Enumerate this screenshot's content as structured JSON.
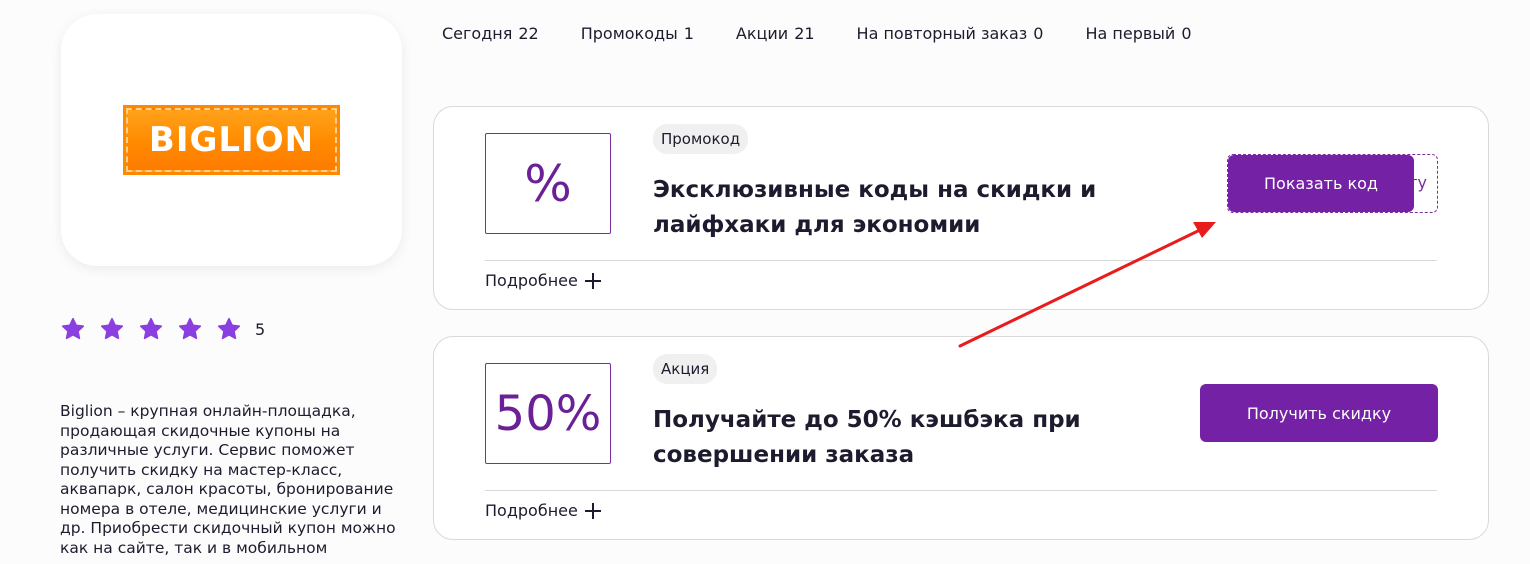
{
  "brand": {
    "logo_text": "BIGLION"
  },
  "rating": {
    "stars": 5,
    "value": "5"
  },
  "description": "Biglion – крупная онлайн-площадка, продающая скидочные купоны на различные услуги. Сервис поможет получить скидку на мастер-класс, аквапарк, салон красоты, бронирование номера в отеле, медицинские услуги и др. Приобрести скидочный купон можно как на сайте, так и в мобильном",
  "tabs": [
    {
      "label": "Сегодня",
      "count": "22"
    },
    {
      "label": "Промокоды",
      "count": "1"
    },
    {
      "label": "Акции",
      "count": "21"
    },
    {
      "label": "На повторный заказ",
      "count": "0"
    },
    {
      "label": "На первый",
      "count": "0"
    }
  ],
  "offers": [
    {
      "badge": "%",
      "type": "Промокод",
      "title": "Эксклюзивные коды на скидки и лайфхаки для экономии",
      "more": "Подробнее",
      "button": "Показать код",
      "code_peek": "ту"
    },
    {
      "badge": "50%",
      "type": "Акция",
      "title": "Получайте до 50% кэшбэка при совершении заказа",
      "more": "Подробнее",
      "button": "Получить скидку"
    }
  ],
  "colors": {
    "accent": "#7421a6",
    "star": "#8b3fe0",
    "arrow": "#e81c1c",
    "logo": "#ff8a00"
  }
}
